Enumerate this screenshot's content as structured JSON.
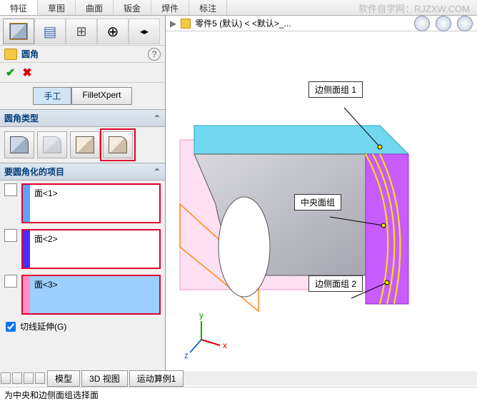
{
  "watermark": "软件自学网：RJZXW.COM",
  "top_tabs": [
    "特征",
    "草图",
    "曲面",
    "钣金",
    "焊件",
    "标注"
  ],
  "doc_name": "零件5 (默认) < <默认>_...",
  "feature": {
    "title": "圆角",
    "mode_manual": "手工",
    "mode_expert": "FilletXpert",
    "section_type": "圆角类型",
    "section_items": "要圆角化的项目",
    "item1": "面<1>",
    "item2": "面<2>",
    "item3": "面<3>",
    "tangent_cb": "切线延伸(G)"
  },
  "callouts": {
    "c1": "边侧面组 1",
    "c2": "中央面组",
    "c3": "边侧面组 2"
  },
  "bottom_tabs": [
    "模型",
    "3D 视图",
    "运动算例1"
  ],
  "status": "为中央和边侧面组选择面",
  "chart_data": {
    "type": "3d-cad-viewport",
    "feature": "FaceFillet",
    "selections": [
      {
        "label": "边侧面组 1",
        "role": "side-face-set-1",
        "color": "#72d8f0"
      },
      {
        "label": "中央面组",
        "role": "center-face-set",
        "color": "#c2a8ff"
      },
      {
        "label": "边侧面组 2",
        "role": "side-face-set-2",
        "color": "#c95cff"
      }
    ],
    "preview_curves": "yellow-fillet-isocurves"
  }
}
